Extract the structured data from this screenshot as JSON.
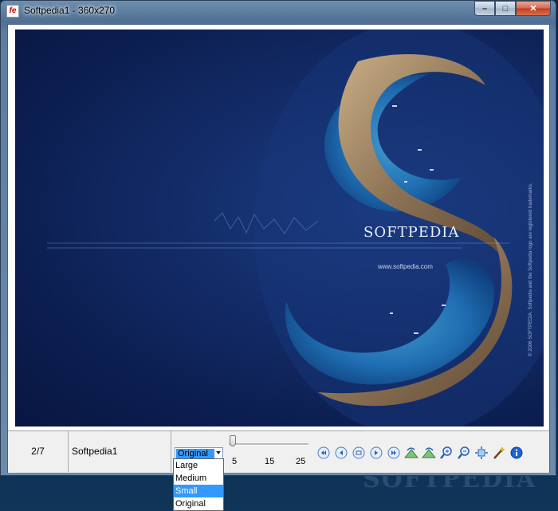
{
  "desktop": {
    "watermark": "SOFTPEDIA"
  },
  "window": {
    "title": "Softpedia1 - 360x270",
    "app_icon_text": "fe",
    "minimize_glyph": "–",
    "maximize_glyph": "□",
    "close_glyph": "✕"
  },
  "image": {
    "brand_text": "SOFTPEDIA",
    "url_text": "www.softpedia.com",
    "vertical_text": "© 2006 SOFTPEDIA. Softpedia and the Softpedia logo are registered trademarks."
  },
  "statusbar": {
    "counter": "2/7",
    "image_name": "Softpedia1",
    "zoom_mode": "Original",
    "zoom_options": [
      "Large",
      "Medium",
      "Small",
      "Original"
    ],
    "zoom_highlighted": "Small",
    "slider_ticks": [
      "5",
      "15",
      "25"
    ],
    "slider_value": 5
  },
  "toolbar": {
    "buttons": [
      {
        "name": "first-image-icon"
      },
      {
        "name": "previous-image-icon"
      },
      {
        "name": "slideshow-icon"
      },
      {
        "name": "next-image-icon"
      },
      {
        "name": "last-image-icon"
      },
      {
        "name": "rotate-left-icon"
      },
      {
        "name": "rotate-right-icon"
      },
      {
        "name": "zoom-in-icon"
      },
      {
        "name": "zoom-out-icon"
      },
      {
        "name": "fit-to-window-icon"
      },
      {
        "name": "magic-wand-icon"
      },
      {
        "name": "info-icon"
      }
    ]
  },
  "colors": {
    "accent": "#3399ff",
    "image_bg": "#0c1f52",
    "window_frame": "#5b7da1"
  }
}
